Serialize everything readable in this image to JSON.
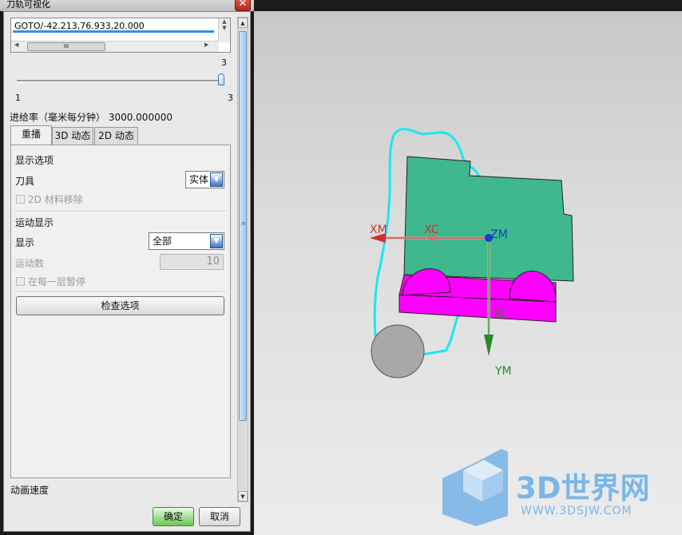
{
  "window": {
    "title": "刀轨可视化",
    "close_icon": "close-icon"
  },
  "list": {
    "current_line": "GOTO/-42.213,76.933,20.000",
    "hscroll_grip": "III"
  },
  "slider": {
    "value": 3,
    "min": 1,
    "max": 3,
    "value_label": "3",
    "min_label": "1",
    "max_label": "3"
  },
  "feed_rate": "进给率（毫米每分钟） 3000.000000",
  "tabs": [
    {
      "label": "重播",
      "active": true
    },
    {
      "label": "3D 动态",
      "active": false
    },
    {
      "label": "2D 动态",
      "active": false
    }
  ],
  "replay": {
    "display_options_heading": "显示选项",
    "tool_label": "刀具",
    "tool_value": "实体",
    "material_removal_2d_label": "2D 材料移除",
    "motion_display_heading": "运动显示",
    "display_label": "显示",
    "display_value": "全部",
    "motion_count_label": "运动数",
    "motion_count_value": "10",
    "pause_each_layer_label": "在每一层暂停",
    "check_options_button": "检查选项"
  },
  "animation_speed_label": "动画速度",
  "buttons": {
    "ok": "确定",
    "cancel": "取消"
  },
  "viewport": {
    "axis_xm": "XM",
    "axis_xc": "XC",
    "axis_zm": "ZM",
    "axis_yc": "YC",
    "axis_ym": "YM",
    "colors": {
      "toolpath": "#19e8f2",
      "part": "#3fb88e",
      "fixture": "#ff00ff",
      "tool": "#a8a8a8",
      "x_axis": "#d0302a",
      "y_axis": "#2a8a2a",
      "origin": "#1a3ad0"
    }
  },
  "watermark": {
    "brand": "3D世界网",
    "url": "WWW.3DSJW.COM"
  }
}
